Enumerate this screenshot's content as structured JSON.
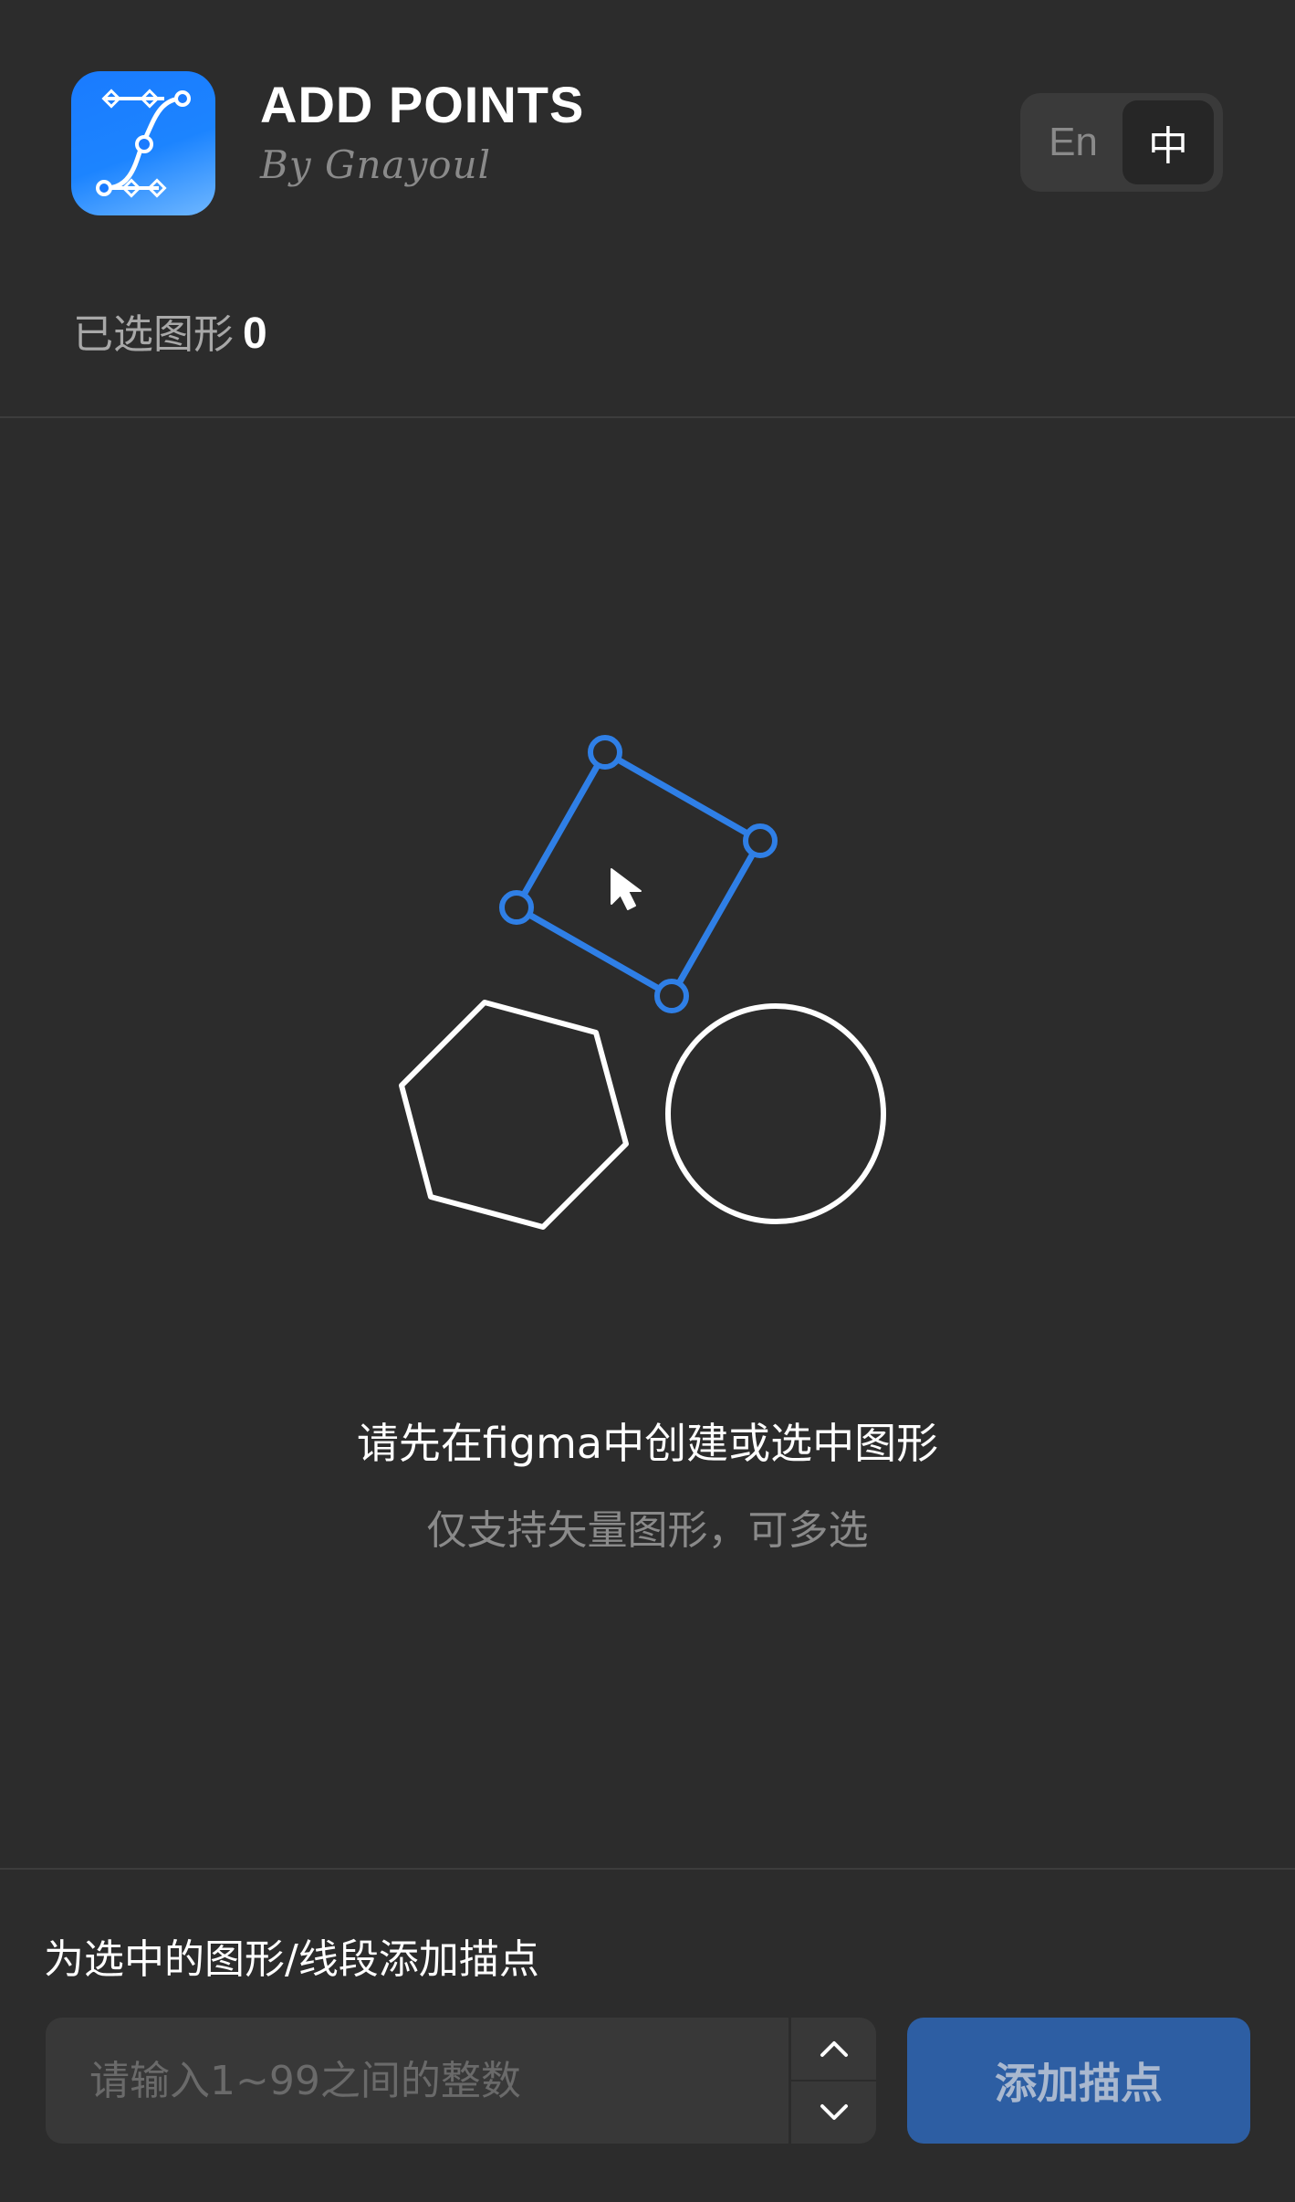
{
  "app": {
    "title": "ADD POINTS",
    "author": "By Gnayoul",
    "icon": "bezier-curve-icon",
    "brand_color": "#1a7bff"
  },
  "language": {
    "options": [
      {
        "code": "en",
        "label": "En",
        "active": false
      },
      {
        "code": "zh",
        "label": "中",
        "active": true
      }
    ]
  },
  "selection": {
    "label": "已选图形",
    "count": "0"
  },
  "empty_state": {
    "illustration": "selected-shapes-illustration",
    "title": "请先在figma中创建或选中图形",
    "subtitle": "仅支持矢量图形，可多选",
    "accent_color": "#2f7fe6"
  },
  "footer": {
    "label": "为选中的图形/线段添加描点",
    "input": {
      "placeholder": "请输入1~99之间的整数",
      "value": ""
    },
    "stepper": {
      "up_icon": "chevron-up-icon",
      "down_icon": "chevron-down-icon"
    },
    "add_button_label": "添加描点",
    "button_color": "#2d5ea3"
  }
}
